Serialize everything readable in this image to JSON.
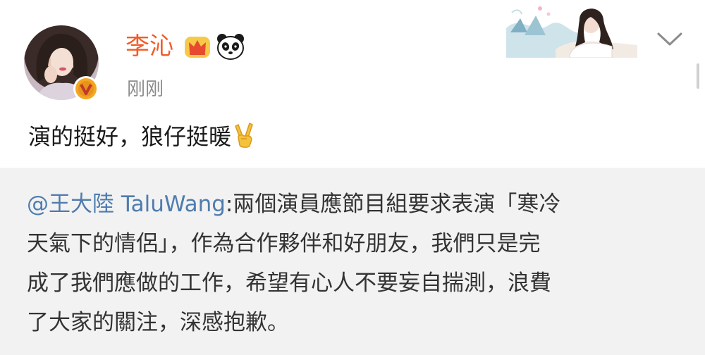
{
  "author": {
    "name": "李沁",
    "time": "刚刚",
    "name_color": "#f25b26"
  },
  "post": {
    "text": "演的挺好，狼仔挺暖",
    "emoji": "victory-hand-icon"
  },
  "repost": {
    "mention": "@王大陸 TaluWang",
    "line1": ":兩個演員應節目組要求表演「寒冷",
    "line2": "天氣下的情侶」，作為合作夥伴和好朋友，我們只是完",
    "line3": "成了我們應做的工作，希望有心人不要妄自揣測，浪費",
    "line4": "了大家的關注，深感抱歉。",
    "mention_color": "#4f7cae",
    "background": "#f2f2f2"
  },
  "icons": [
    "crown-icon",
    "panda-icon",
    "verified-badge-icon",
    "chevron-down-icon"
  ]
}
